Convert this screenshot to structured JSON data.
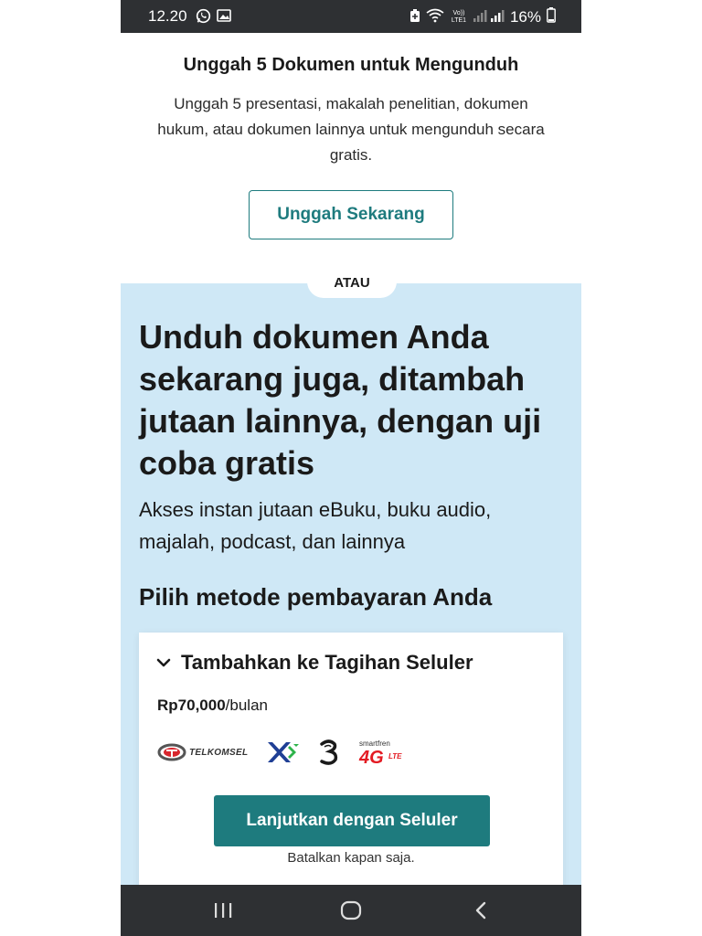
{
  "status_bar": {
    "time": "12.20",
    "battery": "16%",
    "icons": [
      "whatsapp-icon",
      "image-icon",
      "battery-saver-icon",
      "wifi-icon",
      "volte-icon",
      "signal-icon",
      "battery-icon"
    ],
    "volte_label": "Vo)) LTE1"
  },
  "upload": {
    "title": "Unggah 5 Dokumen untuk Mengunduh",
    "description": "Unggah 5 presentasi, makalah penelitian, dokumen hukum, atau dokumen lainnya untuk mengunduh secara gratis.",
    "button_label": "Unggah Sekarang"
  },
  "divider_label": "ATAU",
  "trial": {
    "headline": "Unduh dokumen Anda sekarang juga, ditambah jutaan lainnya, dengan uji coba gratis",
    "subheadline": "Akses instan jutaan eBuku, buku audio, majalah, podcast, dan lainnya",
    "payment_title": "Pilih metode pembayaran Anda"
  },
  "payment_card": {
    "header": "Tambahkan ke Tagihan Seluler",
    "price_amount": "Rp70,000",
    "price_period": "/bulan",
    "carriers": [
      "TELKOMSEL",
      "XL",
      "3",
      "smartfren 4G LTE"
    ],
    "cta_label": "Lanjutkan dengan Seluler",
    "cancel_note": "Batalkan kapan saja."
  },
  "nav_bar": {
    "buttons": [
      "recent-apps-icon",
      "home-icon",
      "back-icon"
    ]
  },
  "colors": {
    "accent": "#1e7b7e",
    "promo_bg": "#cfe8f6",
    "status_bar_bg": "#2e3033"
  }
}
